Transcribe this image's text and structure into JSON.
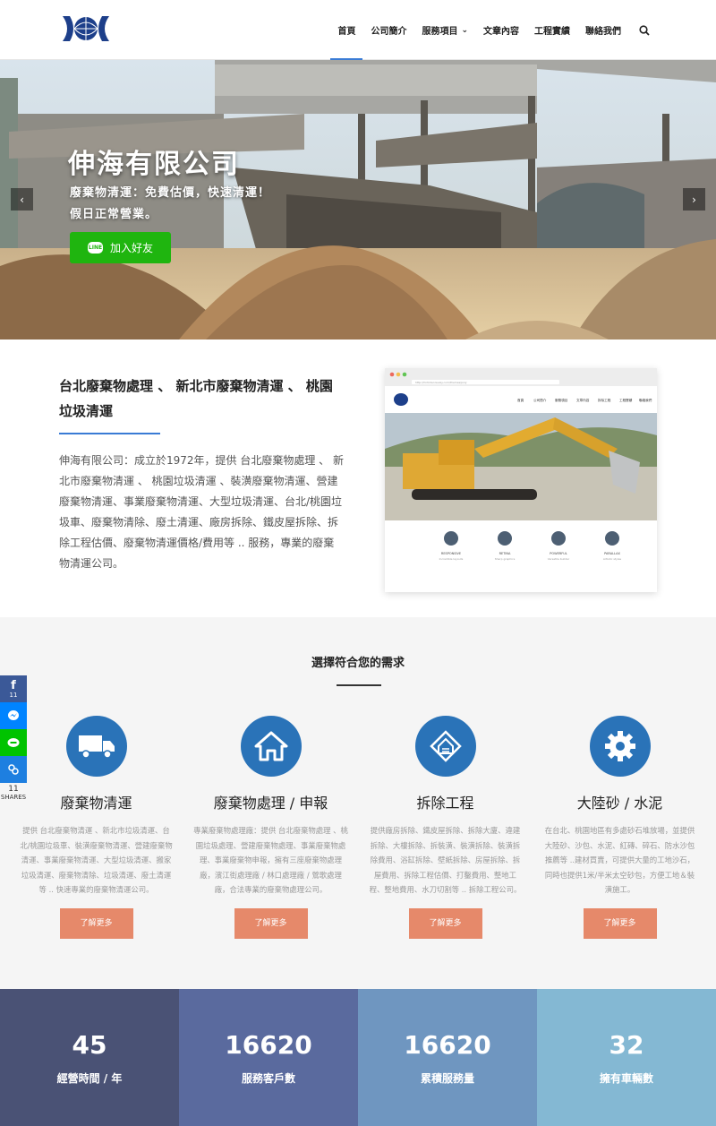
{
  "nav": {
    "items": [
      {
        "label": "首頁",
        "active": true
      },
      {
        "label": "公司簡介"
      },
      {
        "label": "服務項目",
        "dropdown": true
      },
      {
        "label": "文章內容"
      },
      {
        "label": "工程實績"
      },
      {
        "label": "聯絡我們"
      }
    ],
    "search_icon": "search-icon"
  },
  "hero": {
    "title": "伸海有限公司",
    "subtitle_line1": "廢棄物清運：免費估價，快速清運！",
    "subtitle_line2": "假日正常營業。",
    "line_badge": "LINE",
    "line_button": "加入好友",
    "prev_arrow": "‹",
    "next_arrow": "›"
  },
  "intro": {
    "title": "台北廢棄物處理 、 新北市廢棄物清運 、 桃園垃圾清運",
    "text": "伸海有限公司：成立於1972年，提供 台北廢棄物處理 、 新北市廢棄物清運 、 桃園垃圾清運 、裝潢廢棄物清運、營建廢棄物清運、事業廢棄物清運、大型垃圾清運、台北/桃園垃圾車、廢棄物清除、廢土清運、廠房拆除、鐵皮屋拆除、拆除工程估價、廢棄物清運價格/費用等 .. 服務，專業的廢棄物清運公司。"
  },
  "mock_site": {
    "url": "http://forbidenrevely.com/themes/poly",
    "nav": [
      "首頁",
      "公司簡介",
      "服務項目",
      "文章內容",
      "拆除工程",
      "工程實績",
      "聯絡我們"
    ],
    "features": [
      {
        "name": "RESPONSIVE",
        "desc": "Incredible layouts"
      },
      {
        "name": "RETINA",
        "desc": "Sharp graphics"
      },
      {
        "name": "POWERFUL",
        "desc": "Versatile builder"
      },
      {
        "name": "PARALLAX",
        "desc": "Artistic styles"
      }
    ]
  },
  "services": {
    "title": "選擇符合您的需求",
    "more_label": "了解更多",
    "items": [
      {
        "icon": "truck-icon",
        "name": "廢棄物清運",
        "desc": "提供 台北廢棄物清運 、新北市垃圾清運、台北/桃園垃圾車、裝潢廢棄物清運、營建廢棄物清運、事業廢棄物清運、大型垃圾清運、搬家垃圾清運、廢棄物清除、垃圾清運、廢土清運等 .. 快速專業的廢棄物清運公司。"
      },
      {
        "icon": "home-icon",
        "name": "廢棄物處理 / 申報",
        "desc": "專業廢棄物處理廠：提供 台北廢棄物處理 、桃園垃圾處理、營建廢棄物處理、事業廢棄物處理、事業廢棄物申報，擁有三座廢棄物處理廠，濱江街處理廠 / 林口處理廠 / 鶯歌處理廠，合法專業的廢棄物處理公司。"
      },
      {
        "icon": "demolition-icon",
        "name": "拆除工程",
        "desc": "提供廠房拆除、鐵皮屋拆除、拆除大廈、違建拆除、大樓拆除、拆裝潢、裝潢拆除、裝潢拆除費用、浴缸拆除、壁紙拆除、房屋拆除、拆屋費用、拆除工程估價、打鑿費用、整地工程、整地費用、水刀切割等 .. 拆除工程公司。"
      },
      {
        "icon": "gear-icon",
        "name": "大陸砂 / 水泥",
        "desc": "在台北、桃園地區有多處砂石堆放場，並提供大陸砂、沙包、水泥、紅磚、碎石、防水沙包推薦等 ..建材買賣，可提供大量的工地沙石，同時也提供1米/半米太空砂包，方便工地＆裝潢施工。"
      }
    ]
  },
  "share": {
    "facebook_count": "11",
    "total": "11",
    "label": "SHARES"
  },
  "stats": [
    {
      "value": "45",
      "label": "經營時間 / 年",
      "color": "#4a5275"
    },
    {
      "value": "16620",
      "label": "服務客戶數",
      "color": "#5a6a9e"
    },
    {
      "value": "16620",
      "label": "累積服務量",
      "color": "#6f96c0"
    },
    {
      "value": "32",
      "label": "擁有車輛數",
      "color": "#84b8d3"
    }
  ],
  "colors": {
    "accent": "#3a7bd5",
    "service_icon_bg": "#2a73b8",
    "more_button": "#e6896a",
    "line_green": "#1fb50f"
  }
}
